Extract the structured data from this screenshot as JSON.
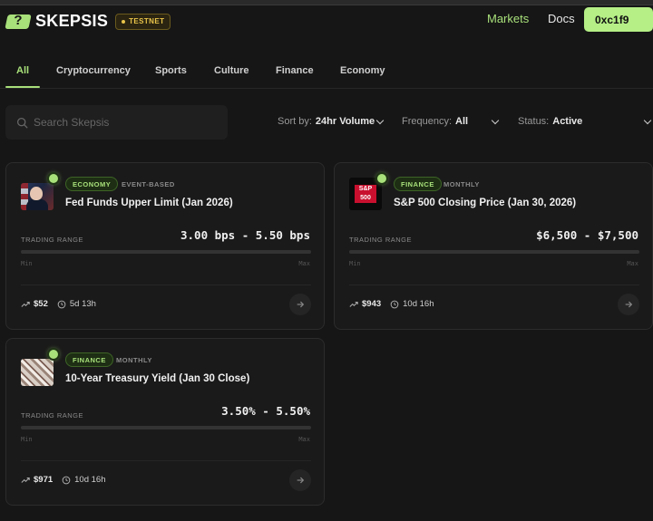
{
  "app": {
    "brand": "SKEPSIS",
    "badge": "TESTNET",
    "accent": "#a8e07a"
  },
  "nav": {
    "markets": "Markets",
    "docs": "Docs",
    "wallet": "0xc1f9"
  },
  "tabs": [
    {
      "label": "All",
      "active": true
    },
    {
      "label": "Cryptocurrency",
      "active": false
    },
    {
      "label": "Sports",
      "active": false
    },
    {
      "label": "Culture",
      "active": false
    },
    {
      "label": "Finance",
      "active": false
    },
    {
      "label": "Economy",
      "active": false
    }
  ],
  "search": {
    "placeholder": "Search Skepsis",
    "value": ""
  },
  "filters": {
    "sort": {
      "label": "Sort by:",
      "value": "24hr Volume"
    },
    "frequency": {
      "label": "Frequency:",
      "value": "All"
    },
    "status": {
      "label": "Status:",
      "value": "Active"
    }
  },
  "cards": [
    {
      "category": "ECONOMY",
      "frequency": "EVENT-BASED",
      "title": "Fed Funds Upper Limit (Jan 2026)",
      "range_label": "TRADING RANGE",
      "range_value": "3.00 bps - 5.50 bps",
      "min_label": "Min",
      "max_label": "Max",
      "volume": "$52",
      "time_left": "5d 13h",
      "thumbnail": "fed-chair-portrait"
    },
    {
      "category": "FINANCE",
      "frequency": "MONTHLY",
      "title": "S&P 500 Closing Price (Jan 30, 2026)",
      "range_label": "TRADING RANGE",
      "range_value": "$6,500 - $7,500",
      "min_label": "Min",
      "max_label": "Max",
      "volume": "$943",
      "time_left": "10d 16h",
      "thumbnail": "sp500-logo",
      "thumbnail_text": "S&P 500"
    },
    {
      "category": "FINANCE",
      "frequency": "MONTHLY",
      "title": "10-Year Treasury Yield (Jan 30 Close)",
      "range_label": "TRADING RANGE",
      "range_value": "3.50% - 5.50%",
      "min_label": "Min",
      "max_label": "Max",
      "volume": "$971",
      "time_left": "10d 16h",
      "thumbnail": "treasury-notes"
    }
  ]
}
